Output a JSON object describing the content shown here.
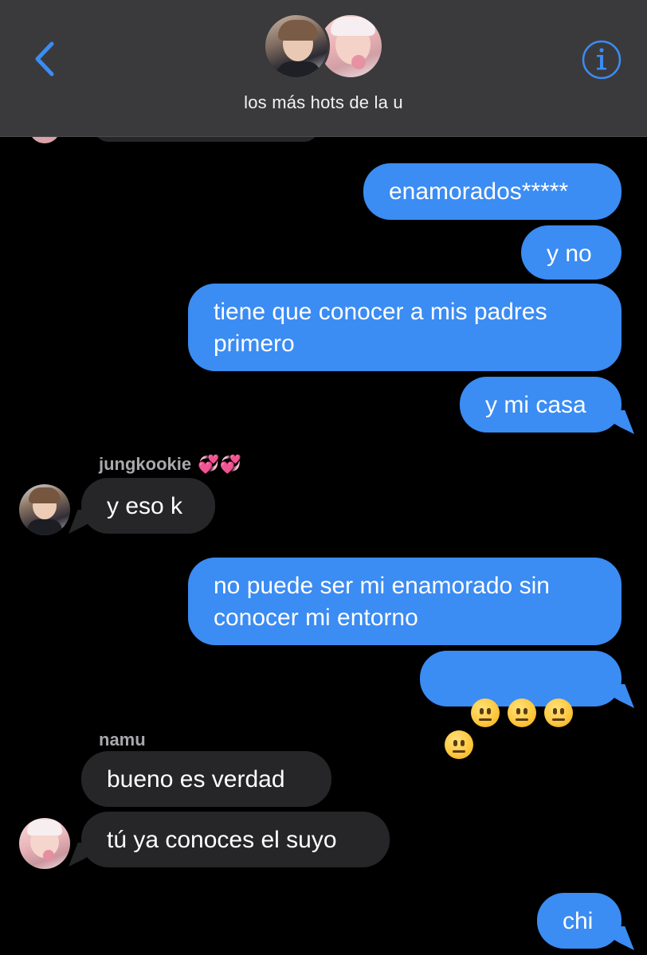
{
  "header": {
    "back_icon": "chevron-left-icon",
    "info_icon": "info-circle-icon",
    "title": "los más hots de la u",
    "accent": "#3b8cf3"
  },
  "messages": [
    {
      "id": "m1",
      "type": "sent",
      "text": "enamorados*****"
    },
    {
      "id": "m2",
      "type": "sent",
      "text": "y no"
    },
    {
      "id": "m3",
      "type": "sent",
      "text": "tiene que conocer a mis padres\nprimero"
    },
    {
      "id": "m4",
      "type": "sent",
      "text": "y mi casa"
    },
    {
      "id": "m5",
      "type": "received",
      "sender": "jungkookie",
      "sender_emoji": "💞💞",
      "text": "y eso k"
    },
    {
      "id": "m6",
      "type": "sent",
      "text": "no puede ser mi enamorado sin\nconocer mi entorno"
    },
    {
      "id": "m7",
      "type": "sent",
      "emoji": "neutral-face-icon",
      "emoji_count": 4
    },
    {
      "id": "m8",
      "type": "received",
      "sender": "namu",
      "text": "bueno es verdad"
    },
    {
      "id": "m9",
      "type": "received",
      "text": "tú ya conoces el suyo"
    },
    {
      "id": "m10",
      "type": "sent",
      "text": "chi"
    }
  ],
  "colors": {
    "sent_bubble": "#3b8cf3",
    "received_bubble": "#262628",
    "header_bg": "#3a3a3c",
    "background": "#000000"
  }
}
